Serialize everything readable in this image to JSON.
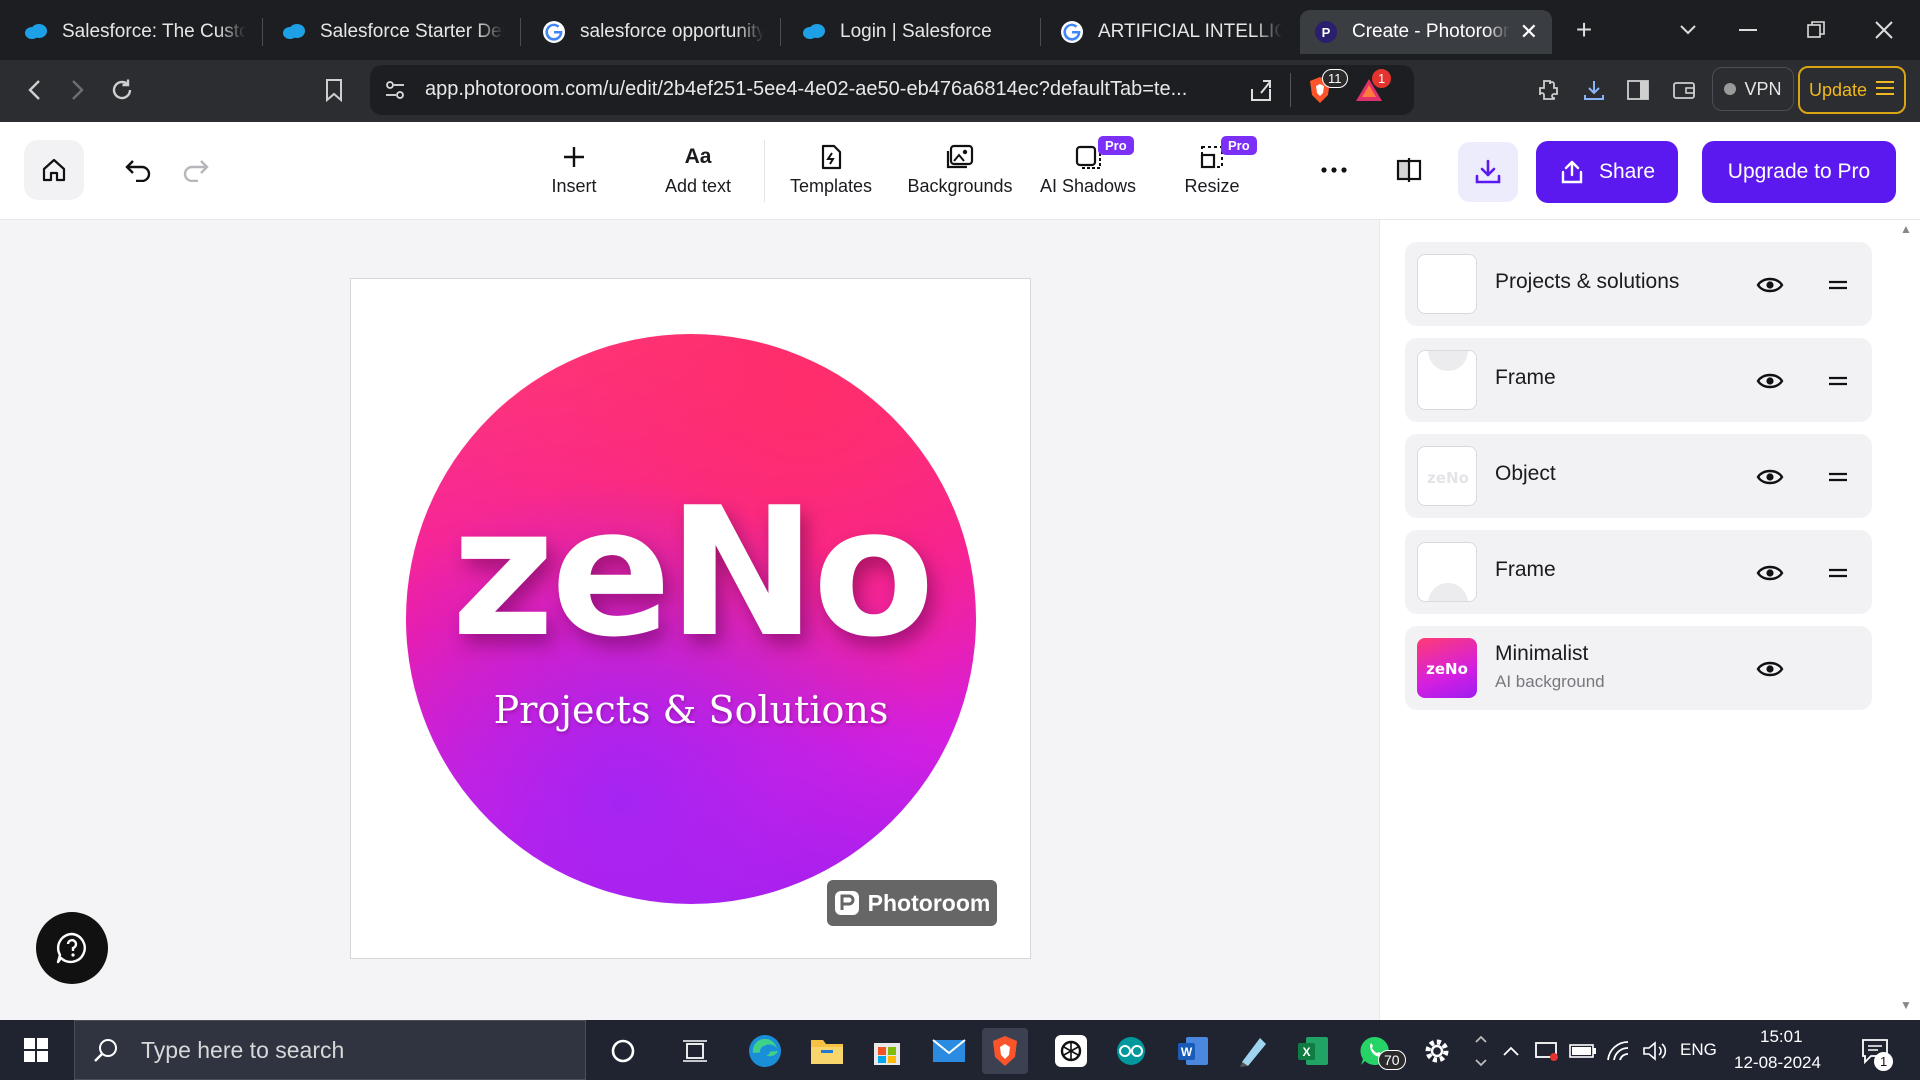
{
  "browser": {
    "tabs": [
      {
        "label": "Salesforce: The Customer Company",
        "icon": "salesforce-cloud-icon"
      },
      {
        "label": "Salesforce Starter Demo",
        "icon": "salesforce-cloud-icon"
      },
      {
        "label": "salesforce opportunity t",
        "icon": "google-icon"
      },
      {
        "label": "Login | Salesforce",
        "icon": "salesforce-cloud-icon"
      },
      {
        "label": "ARTIFICIAL INTELLIGENCE",
        "icon": "google-icon"
      },
      {
        "label": "Create - Photoroom",
        "icon": "photoroom-icon",
        "active": true
      }
    ],
    "url": "app.photoroom.com/u/edit/2b4ef251-5ee4-4e02-ae50-eb476a6814ec?defaultTab=te...",
    "brave_badge": "11",
    "alert_badge": "1",
    "vpn_label": "VPN",
    "update_label": "Update"
  },
  "toolbar": {
    "insert": "Insert",
    "add_text": "Add text",
    "add_text_icon": "Aa",
    "templates": "Templates",
    "backgrounds": "Backgrounds",
    "ai_shadows": "AI Shadows",
    "resize": "Resize",
    "pro_badge": "Pro",
    "share": "Share",
    "upgrade": "Upgrade to Pro"
  },
  "canvas": {
    "logo_word": "zeNo",
    "logo_subtitle": "Projects & Solutions",
    "watermark": "Photoroom"
  },
  "layers": [
    {
      "title": "Projects & solutions",
      "subtitle": "",
      "drag": true,
      "thumb": "blank"
    },
    {
      "title": "Frame",
      "subtitle": "",
      "drag": true,
      "thumb": "frame-top"
    },
    {
      "title": "Object",
      "subtitle": "",
      "drag": true,
      "thumb": "object"
    },
    {
      "title": "Frame",
      "subtitle": "",
      "drag": true,
      "thumb": "frame-bottom"
    },
    {
      "title": "Minimalist",
      "subtitle": "AI background",
      "drag": false,
      "thumb": "background"
    }
  ],
  "taskbar": {
    "search_placeholder": "Type here to search",
    "whatsapp_badge": "70",
    "language": "ENG",
    "time": "15:01",
    "date": "12-08-2024",
    "notification_count": "1"
  },
  "colors": {
    "accent": "#5b19f0",
    "pro_badge": "#7b2ff7",
    "logo_pink": "#f21da6",
    "logo_purple": "#9e1df0"
  }
}
